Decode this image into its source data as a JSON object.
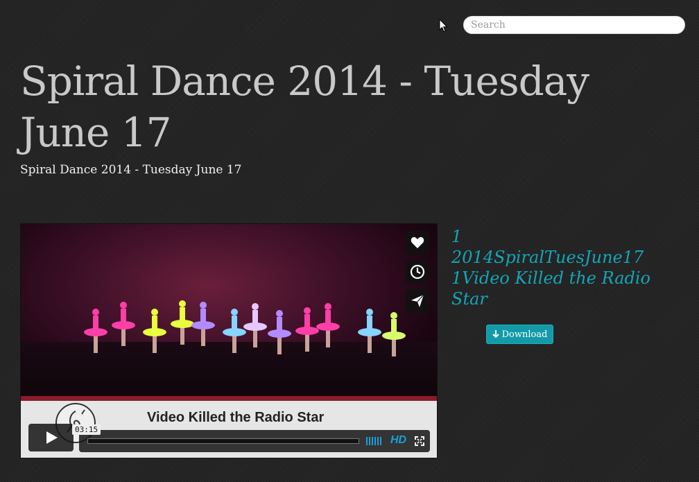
{
  "search": {
    "placeholder": "Search"
  },
  "page": {
    "title": "Spiral Dance 2014 - Tuesday June 17",
    "subtitle": "Spiral Dance 2014 - Tuesday June 17"
  },
  "player": {
    "caption": "Video Killed the Radio Star",
    "time": "03:15",
    "hd_label": "HD",
    "side_buttons": [
      "heart-icon",
      "clock-icon",
      "send-icon"
    ]
  },
  "video": {
    "title": "1 2014SpiralTuesJune17 1Video Killed the Radio Star",
    "download_label": "Download",
    "download_icon": "arrow-down-icon"
  },
  "colors": {
    "accent": "#13a6b8",
    "button": "#139aa8",
    "background": "#252525",
    "hd": "#1aa0d6"
  }
}
